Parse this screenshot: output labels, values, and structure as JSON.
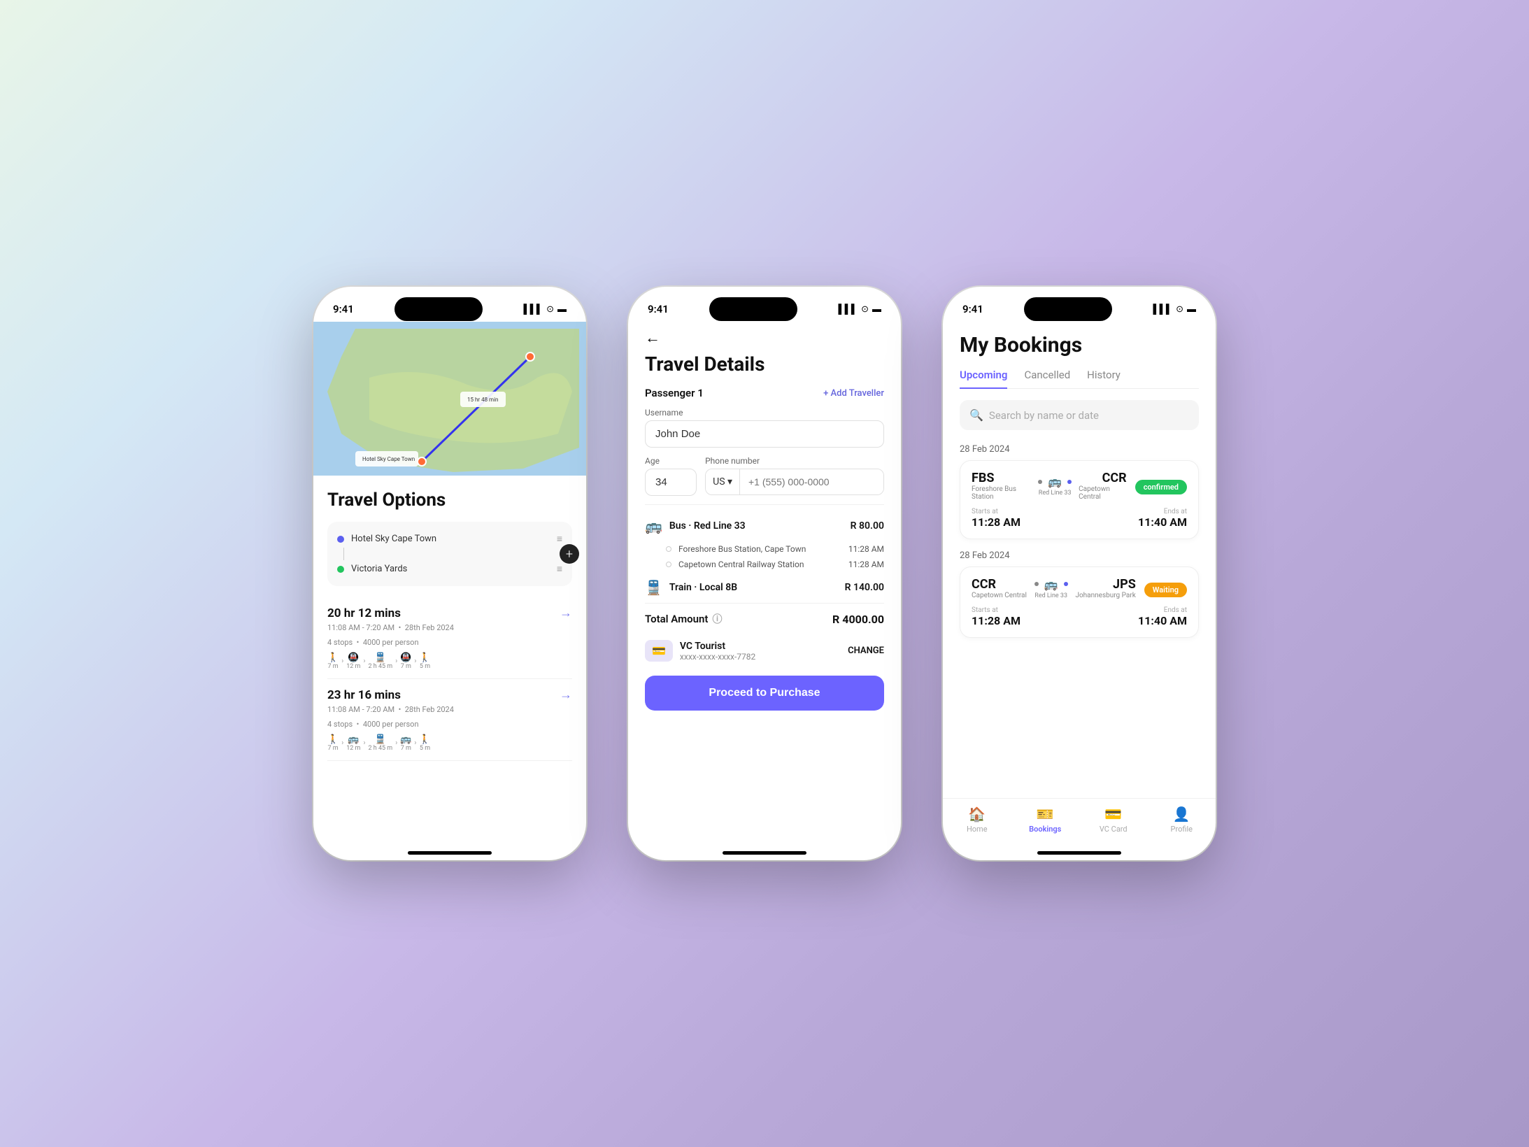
{
  "bg": {
    "gradient_start": "#c8e8c8",
    "gradient_end": "#b8a8d8"
  },
  "phone1": {
    "status": {
      "time": "9:41",
      "signal": "▌▌▌",
      "wifi": "wifi",
      "battery": "battery"
    },
    "title": "Travel Options",
    "route": {
      "from": "Hotel Sky Cape Town",
      "to": "Victoria Yards",
      "add_button": "+"
    },
    "options": [
      {
        "duration": "20 hr 12 mins",
        "time_range": "11:08 AM - 7:20 AM",
        "date": "28th Feb 2024",
        "stops": "4 stops",
        "price": "4000 per person",
        "segments": [
          {
            "icon": "🚶",
            "label": "7 m"
          },
          {
            "sep": "›"
          },
          {
            "icon": "🚇",
            "label": "12 m"
          },
          {
            "sep": "›"
          },
          {
            "icon": "🚆",
            "label": "2 h 45 m"
          },
          {
            "sep": "›"
          },
          {
            "icon": "🚇",
            "label": "7 m"
          },
          {
            "sep": "›"
          },
          {
            "icon": "🚶",
            "label": "5 m"
          }
        ]
      },
      {
        "duration": "23 hr 16 mins",
        "time_range": "11:08 AM - 7:20 AM",
        "date": "28th Feb 2024",
        "stops": "4 stops",
        "price": "4000 per person",
        "segments": [
          {
            "icon": "🚶",
            "label": "7 m"
          },
          {
            "sep": "›"
          },
          {
            "icon": "🚌",
            "label": "12 m"
          },
          {
            "sep": "›"
          },
          {
            "icon": "🚆",
            "label": "2 h 45 m"
          },
          {
            "sep": "›"
          },
          {
            "icon": "🚌",
            "label": "7 m"
          },
          {
            "sep": "›"
          },
          {
            "icon": "🚶",
            "label": "5 m"
          }
        ]
      }
    ]
  },
  "phone2": {
    "status": {
      "time": "9:41"
    },
    "title": "Travel Details",
    "passenger_label": "Passenger 1",
    "add_traveller_label": "+ Add Traveller",
    "username_label": "Username",
    "username_value": "John Doe",
    "age_label": "Age",
    "age_value": "34",
    "phone_label": "Phone number",
    "phone_country": "US ▾",
    "phone_placeholder": "+1 (555) 000-0000",
    "transports": [
      {
        "icon": "🚌",
        "name": "Bus · Red Line 33",
        "price": "R 80.00",
        "stops": [
          {
            "station": "Foreshore Bus Station, Cape Town",
            "time": "11:28 AM"
          },
          {
            "station": "Capetown Central Railway Station",
            "time": "11:28 AM"
          }
        ]
      },
      {
        "icon": "🚆",
        "name": "Train · Local 8B",
        "price": "R 140.00",
        "stops": []
      }
    ],
    "total_label": "Total Amount",
    "total_amount": "R 4000.00",
    "payment_name": "VC Tourist",
    "payment_number": "xxxx-xxxx-xxxx-7782",
    "change_label": "CHANGE",
    "proceed_label": "Proceed to Purchase"
  },
  "phone3": {
    "status": {
      "time": "9:41"
    },
    "title": "My Bookings",
    "tabs": [
      "Upcoming",
      "Cancelled",
      "History"
    ],
    "active_tab": "Upcoming",
    "search_placeholder": "Search by name or date",
    "bookings": [
      {
        "date": "28 Feb 2024",
        "status": "confirmed",
        "status_label": "confirmed",
        "from_code": "FBS",
        "from_name": "Foreshore Bus Station",
        "line": "Red Line 33",
        "to_code": "CCR",
        "to_name": "Capetown Central",
        "starts_label": "Starts at",
        "start_time": "11:28 AM",
        "ends_label": "Ends at",
        "end_time": "11:40 AM"
      },
      {
        "date": "28 Feb 2024",
        "status": "waiting",
        "status_label": "Waiting",
        "from_code": "CCR",
        "from_name": "Capetown Central",
        "line": "Red Line 33",
        "to_code": "JPS",
        "to_name": "Johannesburg Park",
        "starts_label": "Starts at",
        "start_time": "11:28 AM",
        "ends_label": "Ends at",
        "end_time": "11:40 AM"
      }
    ],
    "nav": [
      {
        "icon": "🏠",
        "label": "Home",
        "active": false
      },
      {
        "icon": "🎫",
        "label": "Bookings",
        "active": true
      },
      {
        "icon": "💳",
        "label": "VC Card",
        "active": false
      },
      {
        "icon": "👤",
        "label": "Profile",
        "active": false
      }
    ]
  }
}
